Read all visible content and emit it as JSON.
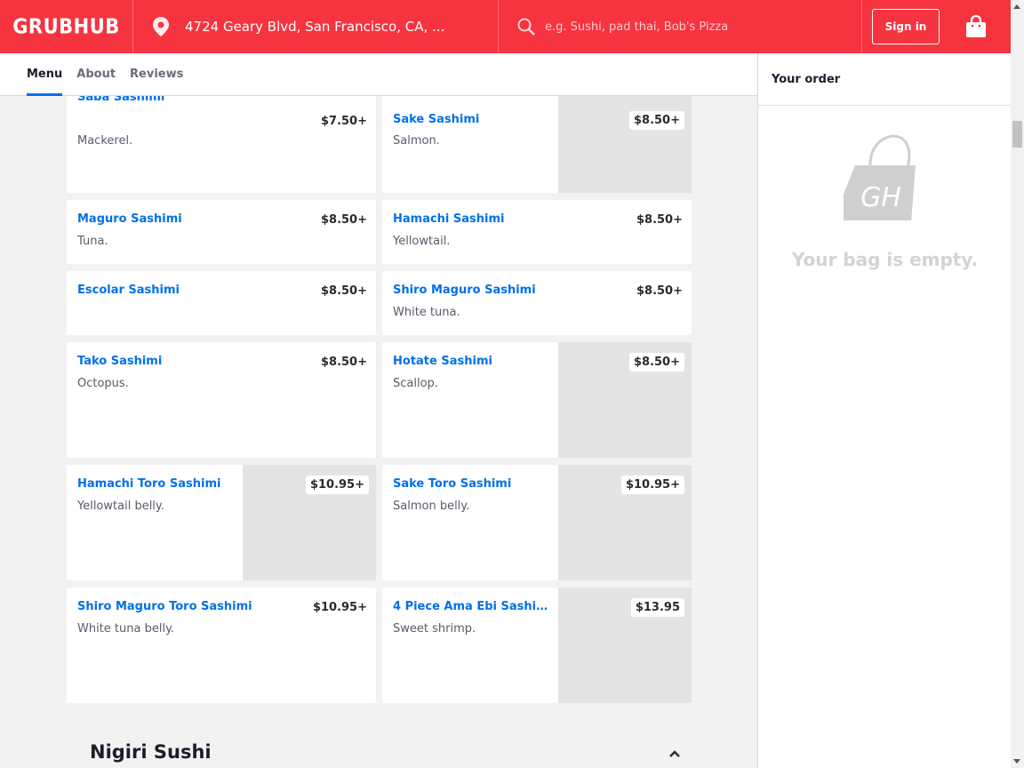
{
  "header": {
    "logo": "GRUBHUB",
    "address": "4724 Geary Blvd, San Francisco, CA, ...",
    "search_placeholder": "e.g. Sushi, pad thai, Bob's Pizza",
    "signin_label": "Sign in",
    "brand_color": "#f63440"
  },
  "tabs": [
    {
      "label": "Menu",
      "active": true
    },
    {
      "label": "About",
      "active": false
    },
    {
      "label": "Reviews",
      "active": false
    }
  ],
  "items": [
    {
      "name": "Saba Sashimi",
      "desc": "Mackerel.",
      "price": "$7.50+"
    },
    {
      "name": "Sake Sashimi",
      "desc": "Salmon.",
      "price": "$8.50+"
    },
    {
      "name": "Maguro Sashimi",
      "desc": "Tuna.",
      "price": "$8.50+"
    },
    {
      "name": "Hamachi Sashimi",
      "desc": "Yellowtail.",
      "price": "$8.50+"
    },
    {
      "name": "Escolar Sashimi",
      "desc": "",
      "price": "$8.50+"
    },
    {
      "name": "Shiro Maguro Sashimi",
      "desc": "White tuna.",
      "price": "$8.50+"
    },
    {
      "name": "Tako Sashimi",
      "desc": "Octopus.",
      "price": "$8.50+"
    },
    {
      "name": "Hotate Sashimi",
      "desc": "Scallop.",
      "price": "$8.50+"
    },
    {
      "name": "Hamachi Toro Sashimi",
      "desc": "Yellowtail belly.",
      "price": "$10.95+"
    },
    {
      "name": "Sake Toro Sashimi",
      "desc": "Salmon belly.",
      "price": "$10.95+"
    },
    {
      "name": "Shiro Maguro Toro Sashimi",
      "desc": "White tuna belly.",
      "price": "$10.95+"
    },
    {
      "name": "4 Piece Ama Ebi Sashi...",
      "desc": "Sweet shrimp.",
      "price": "$13.95"
    }
  ],
  "next_section": "Nigiri Sushi",
  "order": {
    "title": "Your order",
    "empty_text": "Your bag is empty.",
    "bag_logo": "GH"
  }
}
